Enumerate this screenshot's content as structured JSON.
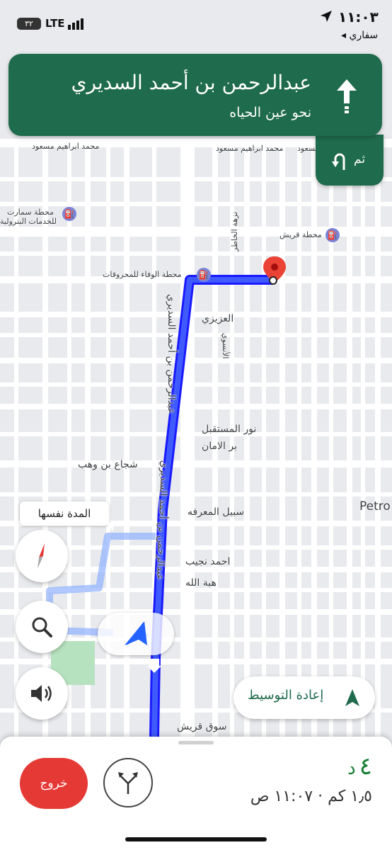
{
  "status_bar": {
    "time": "١١:٠٣",
    "back_app": "سفاري",
    "battery": "٣٢",
    "network": "LTE"
  },
  "nav_banner": {
    "street": "عبدالرحمن بن أحمد السديري",
    "direction": "نحو عين الحياه",
    "then_label": "ثم"
  },
  "map": {
    "labels": {
      "mohammed_ibrahim_1": "محمد ابراهيم مسعود",
      "mohammed_ibrahim_2": "محمد ابراهيم مسعود",
      "mohammed_ibrahim_3": "محمد ابراهيم مسعود",
      "station_smart": "محطة سمارت",
      "station_smart_2": "للخدمات البترولية",
      "station_quraish": "محطة قريش",
      "station_wafaa": "محطة الوفاء للمحروقات",
      "nazha": "نزهة الخاطر",
      "main_road": "عبدالرحمن بن أحمد السديري",
      "main_road_2": "عبدالرحمن بن أحمد السديري",
      "alazizi": "العزيزي",
      "alansawi": "الأنسوي",
      "noor": "نور المستقبل",
      "bir": "بر الامان",
      "shujaa": "شجاع بن وهب",
      "sabeel": "سبيل المعرفه",
      "ahmed": "احمد نجيب",
      "hibat": "هبة الله",
      "petro": "Petro",
      "souq": "سوق قريش"
    },
    "alt_route_label": "المدة نفسها"
  },
  "recenter_label": "إعادة التوسيط",
  "trip": {
    "minutes": "٤",
    "minutes_unit": "د",
    "distance": "١٫٥ كم",
    "arrival": "١١:٠٧ ص",
    "exit_label": "خروج"
  },
  "colors": {
    "banner": "#1f6b4d",
    "route": "#1a3fff",
    "exit": "#e53935",
    "eta_green": "#188038"
  }
}
